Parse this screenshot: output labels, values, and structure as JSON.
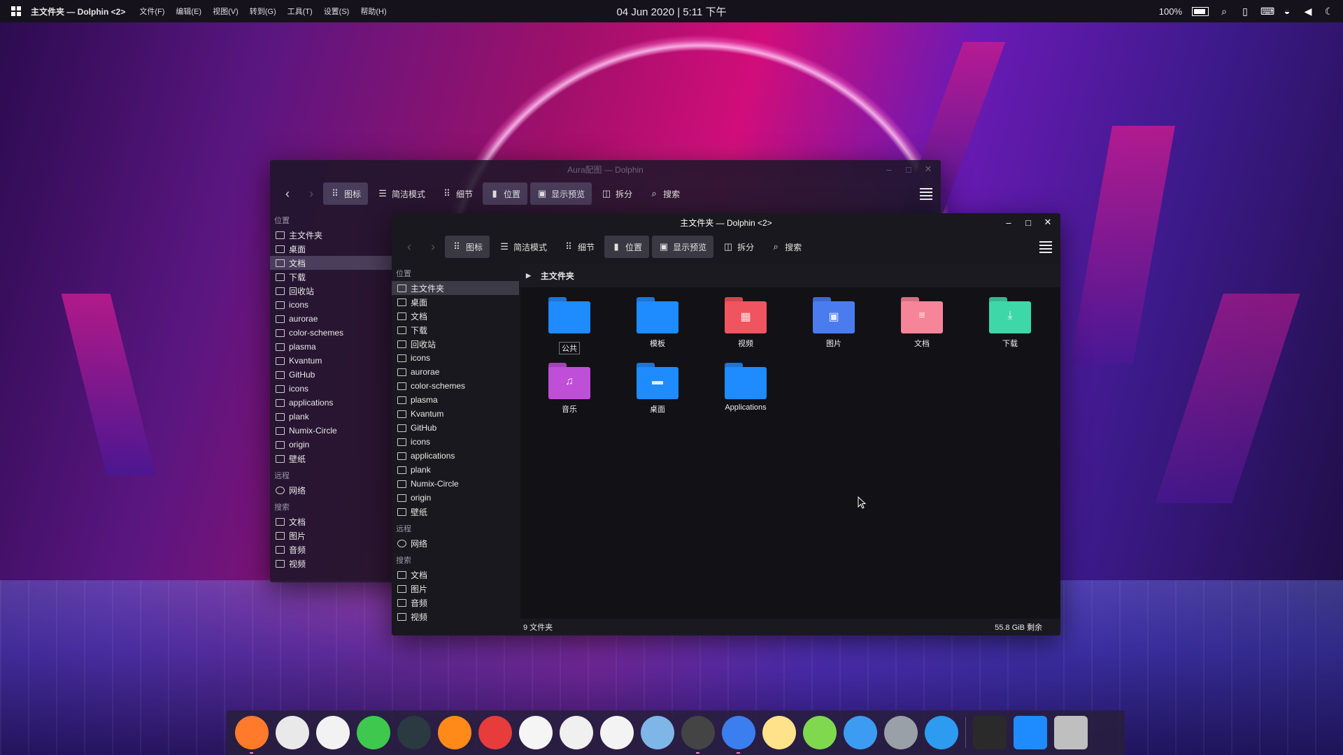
{
  "panel": {
    "app_title": "主文件夹 — Dolphin <2>",
    "menus": [
      "文件(F)",
      "编辑(E)",
      "视图(V)",
      "转到(G)",
      "工具(T)",
      "设置(S)",
      "帮助(H)"
    ],
    "clock": "04 Jun 2020 | 5:11 下午",
    "battery": "100%"
  },
  "back_window": {
    "title": "Aura配图 — Dolphin",
    "toolbar": {
      "icons": "图标",
      "compact": "简洁模式",
      "details": "细节",
      "places": "位置",
      "preview": "显示预览",
      "split": "拆分",
      "search": "搜索"
    },
    "places_head": "位置",
    "places": [
      "主文件夹",
      "桌面",
      "文档",
      "下载",
      "回收站",
      "icons",
      "aurorae",
      "color-schemes",
      "plasma",
      "Kvantum",
      "GitHub",
      "icons",
      "applications",
      "plank",
      "Numix-Circle",
      "origin",
      "壁纸"
    ],
    "remote_head": "远程",
    "remote": [
      "网络"
    ],
    "search_head": "搜索",
    "search": [
      "文档",
      "图片",
      "音频",
      "视频"
    ]
  },
  "front_window": {
    "title": "主文件夹 — Dolphin <2>",
    "toolbar": {
      "icons": "图标",
      "compact": "简洁模式",
      "details": "细节",
      "places": "位置",
      "preview": "显示预览",
      "split": "拆分",
      "search": "搜索"
    },
    "places_head": "位置",
    "places": [
      "主文件夹",
      "桌面",
      "文档",
      "下载",
      "回收站",
      "icons",
      "aurorae",
      "color-schemes",
      "plasma",
      "Kvantum",
      "GitHub",
      "icons",
      "applications",
      "plank",
      "Numix-Circle",
      "origin",
      "壁纸"
    ],
    "remote_head": "远程",
    "remote": [
      "网络"
    ],
    "search_head": "搜索",
    "search": [
      "文档",
      "图片",
      "音频",
      "视频"
    ],
    "breadcrumb": "主文件夹",
    "folders": [
      {
        "name": "公共",
        "color": "#1e8bff",
        "glyph": ""
      },
      {
        "name": "模板",
        "color": "#1e8bff",
        "glyph": ""
      },
      {
        "name": "视频",
        "color": "#f0555f",
        "glyph": "▦"
      },
      {
        "name": "图片",
        "color": "#4a7cf0",
        "glyph": "▣"
      },
      {
        "name": "文档",
        "color": "#f7859a",
        "glyph": "≡"
      },
      {
        "name": "下载",
        "color": "#3ed7a8",
        "glyph": "⤓"
      },
      {
        "name": "音乐",
        "color": "#c04fd8",
        "glyph": "♫"
      },
      {
        "name": "桌面",
        "color": "#1e8bff",
        "glyph": "▬"
      },
      {
        "name": "Applications",
        "color": "#1e8bff",
        "glyph": ""
      }
    ],
    "status_count": "9 文件夹",
    "status_free": "55.8 GiB 剩余"
  },
  "dock_apps": [
    {
      "name": "firefox",
      "color": "#ff7a2a"
    },
    {
      "name": "chrome",
      "color": "#e9e9e9"
    },
    {
      "name": "github",
      "color": "#f2f2f2"
    },
    {
      "name": "atom",
      "color": "#3ec84e"
    },
    {
      "name": "inkscape",
      "color": "#2a3a40"
    },
    {
      "name": "vlc",
      "color": "#ff8a1a"
    },
    {
      "name": "netease-music",
      "color": "#e83b3b"
    },
    {
      "name": "mail",
      "color": "#f5f5f5"
    },
    {
      "name": "qq",
      "color": "#f0f0f0"
    },
    {
      "name": "notes",
      "color": "#f3f3f3"
    },
    {
      "name": "browser",
      "color": "#7fb6e8"
    },
    {
      "name": "terminal",
      "color": "#444"
    },
    {
      "name": "finder",
      "color": "#3b7ef0"
    },
    {
      "name": "notepad",
      "color": "#ffe28a"
    },
    {
      "name": "maps",
      "color": "#7fd84e"
    },
    {
      "name": "share",
      "color": "#3b9cf2"
    },
    {
      "name": "settings",
      "color": "#9aa0a8"
    },
    {
      "name": "safari",
      "color": "#2d9bf0"
    },
    {
      "name": "launcher",
      "color": "#2a2a2a"
    },
    {
      "name": "files",
      "color": "#1e8bff"
    },
    {
      "name": "trash",
      "color": "#bfbfbf"
    }
  ]
}
